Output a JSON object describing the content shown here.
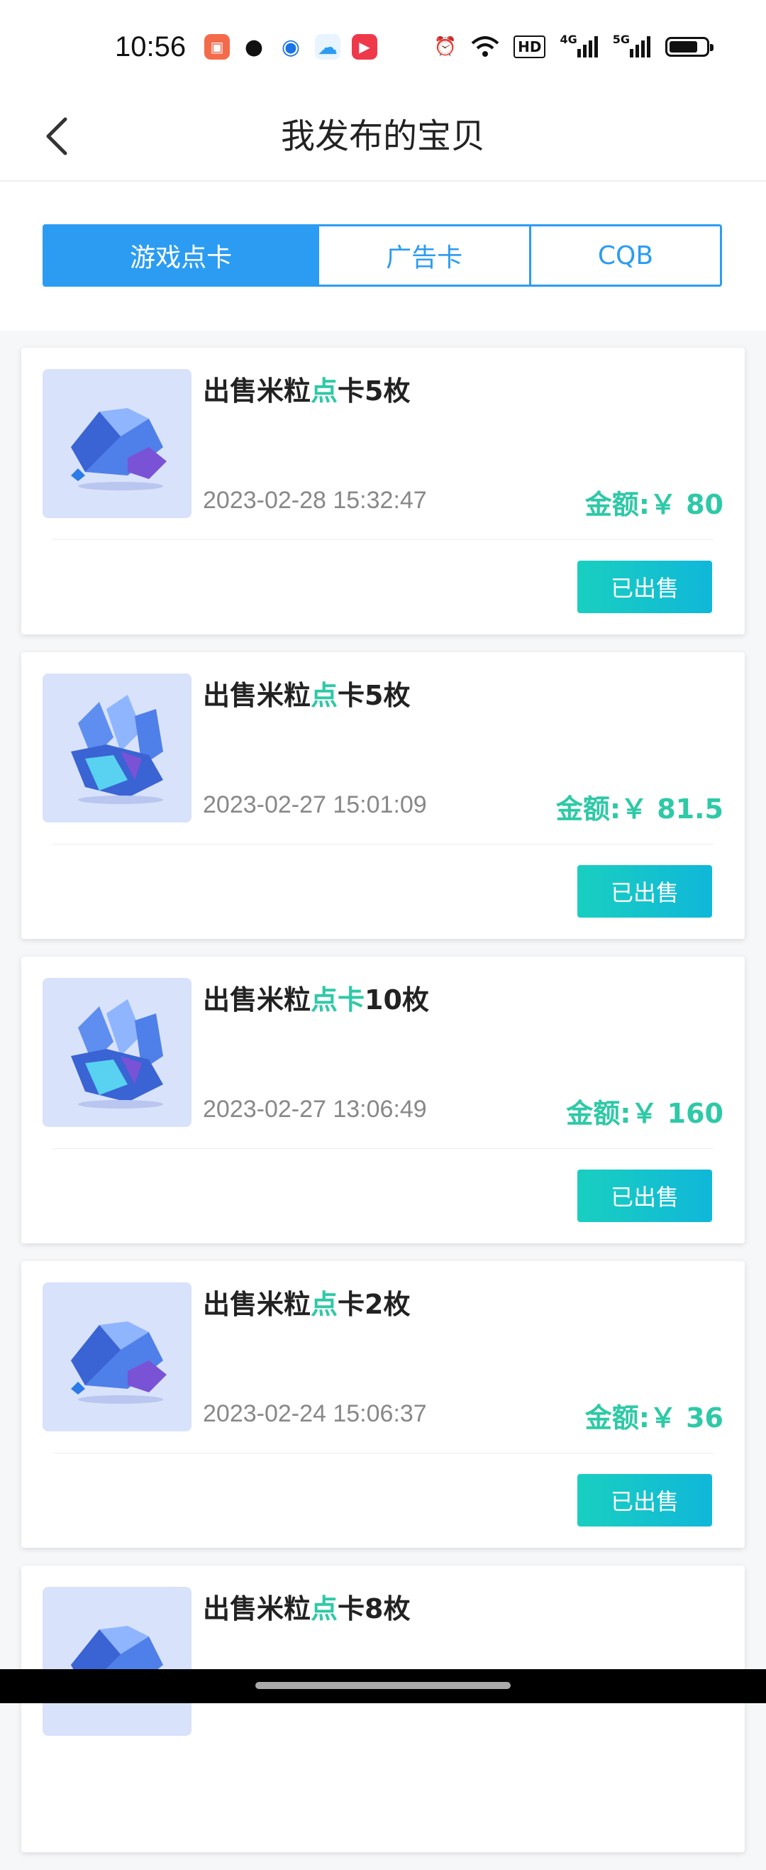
{
  "status_bar": {
    "time": "10:56",
    "network_1": "4G",
    "network_2": "5G",
    "hd_label": "HD"
  },
  "header": {
    "title": "我发布的宝贝"
  },
  "tabs": [
    {
      "label": "游戏点卡",
      "active": true
    },
    {
      "label": "广告卡",
      "active": false
    },
    {
      "label": "CQB",
      "active": false
    }
  ],
  "items": [
    {
      "title_pre": "出售米粒",
      "title_hl": "点",
      "title_post": "卡5枚",
      "date": "2023-02-28 15:32:47",
      "price": "金额:￥ 80",
      "status": "已出售",
      "image": "gem-icon"
    },
    {
      "title_pre": "出售米粒",
      "title_hl": "点",
      "title_post": "卡5枚",
      "date": "2023-02-27 15:01:09",
      "price": "金额:￥ 81.5",
      "status": "已出售",
      "image": "crystal-icon"
    },
    {
      "title_pre": "出售米粒",
      "title_hl": "点卡",
      "title_post": "10枚",
      "date": "2023-02-27 13:06:49",
      "price": "金额:￥ 160",
      "status": "已出售",
      "image": "crystal-icon"
    },
    {
      "title_pre": "出售米粒",
      "title_hl": "点",
      "title_post": "卡2枚",
      "date": "2023-02-24 15:06:37",
      "price": "金额:￥ 36",
      "status": "已出售",
      "image": "gem-icon"
    },
    {
      "title_pre": "出售米粒",
      "title_hl": "点",
      "title_post": "卡8枚",
      "date": "",
      "price": "",
      "status": "",
      "image": "gem-icon"
    }
  ],
  "colors": {
    "accent_blue": "#2b9cf2",
    "accent_green": "#2ec9a6"
  }
}
